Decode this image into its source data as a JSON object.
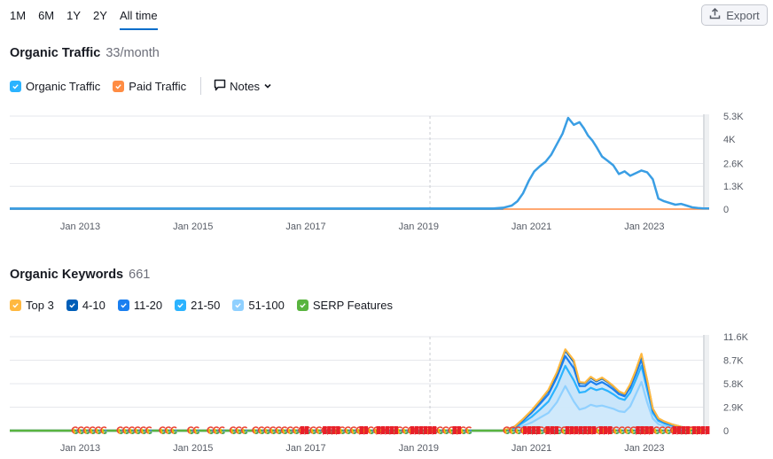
{
  "period_tabs": [
    {
      "label": "1M",
      "active": false
    },
    {
      "label": "6M",
      "active": false
    },
    {
      "label": "1Y",
      "active": false
    },
    {
      "label": "2Y",
      "active": false
    },
    {
      "label": "All time",
      "active": true
    }
  ],
  "export": {
    "label": "Export",
    "icon": "upload-icon"
  },
  "organic_traffic": {
    "title": "Organic Traffic",
    "value": "33/month",
    "legend": [
      {
        "label": "Organic Traffic",
        "checked": true,
        "color": "#2bb3ff"
      },
      {
        "label": "Paid Traffic",
        "checked": true,
        "color": "#ff8c43"
      }
    ],
    "notes_label": "Notes"
  },
  "organic_keywords": {
    "title": "Organic Keywords",
    "value": "661",
    "legend": [
      {
        "label": "Top 3",
        "checked": true,
        "color": "#ffb840"
      },
      {
        "label": "4-10",
        "checked": true,
        "color": "#005eb8"
      },
      {
        "label": "11-20",
        "checked": true,
        "color": "#1a7ff0"
      },
      {
        "label": "21-50",
        "checked": true,
        "color": "#2bb3ff"
      },
      {
        "label": "51-100",
        "checked": true,
        "color": "#8fd0ff"
      },
      {
        "label": "SERP Features",
        "checked": true,
        "color": "#59b43f"
      }
    ]
  },
  "chart_data": [
    {
      "type": "line",
      "title": "Organic Traffic",
      "xlabel": "",
      "ylabel": "",
      "x_ticks": [
        "Jan 2013",
        "Jan 2015",
        "Jan 2017",
        "Jan 2019",
        "Jan 2021",
        "Jan 2023"
      ],
      "y_ticks": [
        "0",
        "1.3K",
        "2.6K",
        "4K",
        "5.3K"
      ],
      "y_tick_values": [
        0,
        1300,
        2600,
        4000,
        5300
      ],
      "ylim": [
        0,
        5300
      ],
      "xlim": [
        2011.75,
        2024.15
      ],
      "grid": true,
      "y_axis_side": "right",
      "annotation_line_x": 2019.2,
      "series": [
        {
          "name": "Organic Traffic",
          "color": "#3a9ee4",
          "x": [
            2011.75,
            2020.3,
            2020.5,
            2020.65,
            2020.75,
            2020.85,
            2020.95,
            2021.05,
            2021.15,
            2021.25,
            2021.35,
            2021.45,
            2021.55,
            2021.65,
            2021.75,
            2021.85,
            2021.93,
            2022.0,
            2022.08,
            2022.16,
            2022.25,
            2022.35,
            2022.45,
            2022.55,
            2022.65,
            2022.75,
            2022.85,
            2022.95,
            2023.05,
            2023.15,
            2023.25,
            2023.35,
            2023.45,
            2023.55,
            2023.65,
            2023.75,
            2023.85,
            2023.95,
            2024.05,
            2024.15
          ],
          "values": [
            30,
            30,
            80,
            200,
            450,
            900,
            1600,
            2150,
            2450,
            2700,
            3100,
            3700,
            4300,
            5200,
            4800,
            4950,
            4600,
            4200,
            3900,
            3500,
            3000,
            2750,
            2500,
            2000,
            2150,
            1900,
            2050,
            2200,
            2100,
            1700,
            600,
            450,
            350,
            250,
            300,
            200,
            100,
            60,
            40,
            33
          ]
        },
        {
          "name": "Paid Traffic",
          "color": "#ff8c43",
          "x": [
            2011.75,
            2024.15
          ],
          "values": [
            0,
            0
          ]
        }
      ]
    },
    {
      "type": "area",
      "title": "Organic Keywords",
      "xlabel": "",
      "ylabel": "",
      "x_ticks": [
        "Jan 2013",
        "Jan 2015",
        "Jan 2017",
        "Jan 2019",
        "Jan 2021",
        "Jan 2023"
      ],
      "y_ticks": [
        "0",
        "2.9K",
        "5.8K",
        "8.7K",
        "11.6K"
      ],
      "y_tick_values": [
        0,
        2900,
        5800,
        8700,
        11600
      ],
      "ylim": [
        0,
        11600
      ],
      "xlim": [
        2011.75,
        2024.15
      ],
      "grid": true,
      "stacked": true,
      "y_axis_side": "right",
      "annotation_line_x": 2019.2,
      "x": [
        2011.75,
        2020.5,
        2020.7,
        2020.85,
        2021.0,
        2021.15,
        2021.3,
        2021.45,
        2021.6,
        2021.75,
        2021.85,
        2021.95,
        2022.05,
        2022.15,
        2022.25,
        2022.35,
        2022.45,
        2022.55,
        2022.65,
        2022.75,
        2022.85,
        2022.95,
        2023.05,
        2023.15,
        2023.25,
        2023.35,
        2023.5,
        2023.7,
        2023.9,
        2024.15
      ],
      "series": [
        {
          "name": "51-100",
          "color": "#8fd0ff",
          "values": [
            0,
            0,
            200,
            600,
            1000,
            1600,
            2200,
            3500,
            5500,
            3600,
            2600,
            2800,
            3200,
            3000,
            3100,
            2900,
            2700,
            2400,
            2300,
            3000,
            4500,
            6000,
            3500,
            1500,
            800,
            600,
            400,
            200,
            80,
            30
          ]
        },
        {
          "name": "21-50",
          "color": "#2bb3ff",
          "values": [
            0,
            0,
            150,
            400,
            700,
            1000,
            1400,
            2000,
            2500,
            2600,
            2100,
            2000,
            2100,
            2000,
            2100,
            2000,
            1800,
            1600,
            1500,
            1700,
            1800,
            2000,
            1600,
            700,
            400,
            300,
            200,
            100,
            40,
            15
          ]
        },
        {
          "name": "11-20",
          "color": "#1a7ff0",
          "values": [
            0,
            0,
            80,
            250,
            500,
            700,
            900,
            1100,
            1200,
            1500,
            800,
            700,
            800,
            700,
            800,
            700,
            600,
            500,
            450,
            600,
            700,
            800,
            600,
            300,
            200,
            150,
            100,
            50,
            20,
            8
          ]
        },
        {
          "name": "4-10",
          "color": "#005eb8",
          "values": [
            0,
            0,
            50,
            150,
            250,
            350,
            450,
            500,
            700,
            800,
            400,
            350,
            450,
            400,
            450,
            400,
            350,
            300,
            250,
            350,
            400,
            600,
            500,
            200,
            100,
            80,
            60,
            30,
            10,
            5
          ]
        },
        {
          "name": "Top 3",
          "color": "#ffb840",
          "values": [
            0,
            0,
            10,
            30,
            50,
            70,
            90,
            100,
            150,
            200,
            100,
            80,
            100,
            90,
            100,
            90,
            80,
            60,
            50,
            70,
            80,
            100,
            80,
            40,
            20,
            15,
            10,
            5,
            2,
            1
          ]
        }
      ],
      "serp_features_line": {
        "name": "SERP Features",
        "color": "#59b43f"
      },
      "markers": {
        "google_update_ranges": [
          [
            2012.9,
            2013.5
          ],
          [
            2013.7,
            2014.3
          ],
          [
            2014.45,
            2014.75
          ],
          [
            2014.95,
            2015.1
          ],
          [
            2015.3,
            2015.55
          ],
          [
            2015.7,
            2016.0
          ],
          [
            2016.1,
            2019.9
          ],
          [
            2020.55,
            2024.1
          ]
        ],
        "red_flag_ranges": [
          [
            2016.9,
            2017.05
          ],
          [
            2017.3,
            2017.6
          ],
          [
            2017.95,
            2018.1
          ],
          [
            2018.25,
            2018.6
          ],
          [
            2018.85,
            2019.3
          ],
          [
            2019.6,
            2019.75
          ],
          [
            2020.85,
            2021.1
          ],
          [
            2021.25,
            2021.45
          ],
          [
            2021.6,
            2022.1
          ],
          [
            2022.2,
            2022.4
          ],
          [
            2022.85,
            2023.15
          ],
          [
            2023.5,
            2023.75
          ],
          [
            2023.85,
            2024.1
          ]
        ]
      }
    }
  ]
}
